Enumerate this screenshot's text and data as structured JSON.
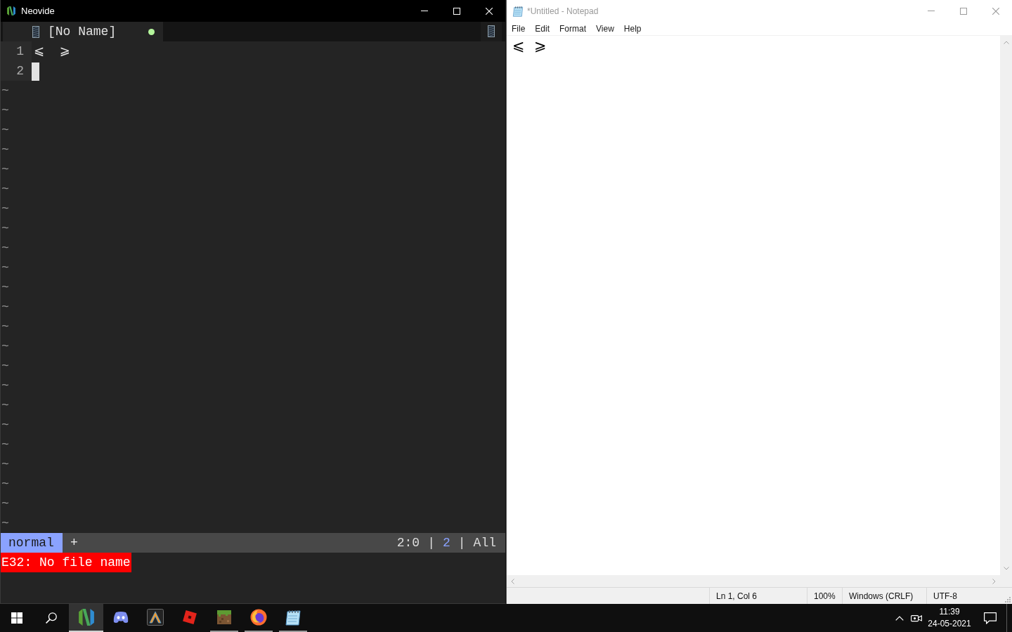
{
  "neovide": {
    "window": {
      "title": "Neovide",
      "active": true
    },
    "tabs": [
      {
        "label": "[No Name]",
        "selected": true,
        "modified": true
      }
    ],
    "lines": [
      {
        "number": "1",
        "text": "⩽  ⩾",
        "cursor": false
      },
      {
        "number": "2",
        "cursor": true
      }
    ],
    "empty_line_markers": [
      "~",
      "~",
      "~",
      "~",
      "~",
      "~",
      "~",
      "~",
      "~",
      "~",
      "~",
      "~",
      "~",
      "~",
      "~",
      "~",
      "~",
      "~",
      "~",
      "~",
      "~",
      "~",
      "~"
    ],
    "statusline": {
      "mode": "normal",
      "modified_flag": "+",
      "segments": [
        {
          "text": "2:0",
          "kind": "text"
        },
        {
          "text": "|",
          "kind": "separator"
        },
        {
          "text": "2",
          "kind": "highlight"
        },
        {
          "text": "|",
          "kind": "separator"
        },
        {
          "text": "All",
          "kind": "text"
        }
      ]
    },
    "message": {
      "text": "E32: No file name",
      "kind": "error"
    }
  },
  "notepad": {
    "window": {
      "title": "*Untitled - Notepad",
      "active": false
    },
    "menu": [
      "File",
      "Edit",
      "Format",
      "View",
      "Help"
    ],
    "content": "⩽  ⩾",
    "status_bar": [
      "Ln 1, Col 6",
      "100%",
      "Windows (CRLF)",
      "UTF-8"
    ]
  },
  "taskbar": {
    "apps": [
      {
        "running": true,
        "selected": true
      },
      {
        "running": false,
        "selected": false
      },
      {
        "running": false,
        "selected": false
      },
      {
        "running": false,
        "selected": false
      },
      {
        "running": true,
        "selected": false
      },
      {
        "running": true,
        "selected": false
      },
      {
        "running": true,
        "selected": false
      }
    ],
    "clock": {
      "time": "11:39",
      "date": "24-05-2021"
    }
  }
}
